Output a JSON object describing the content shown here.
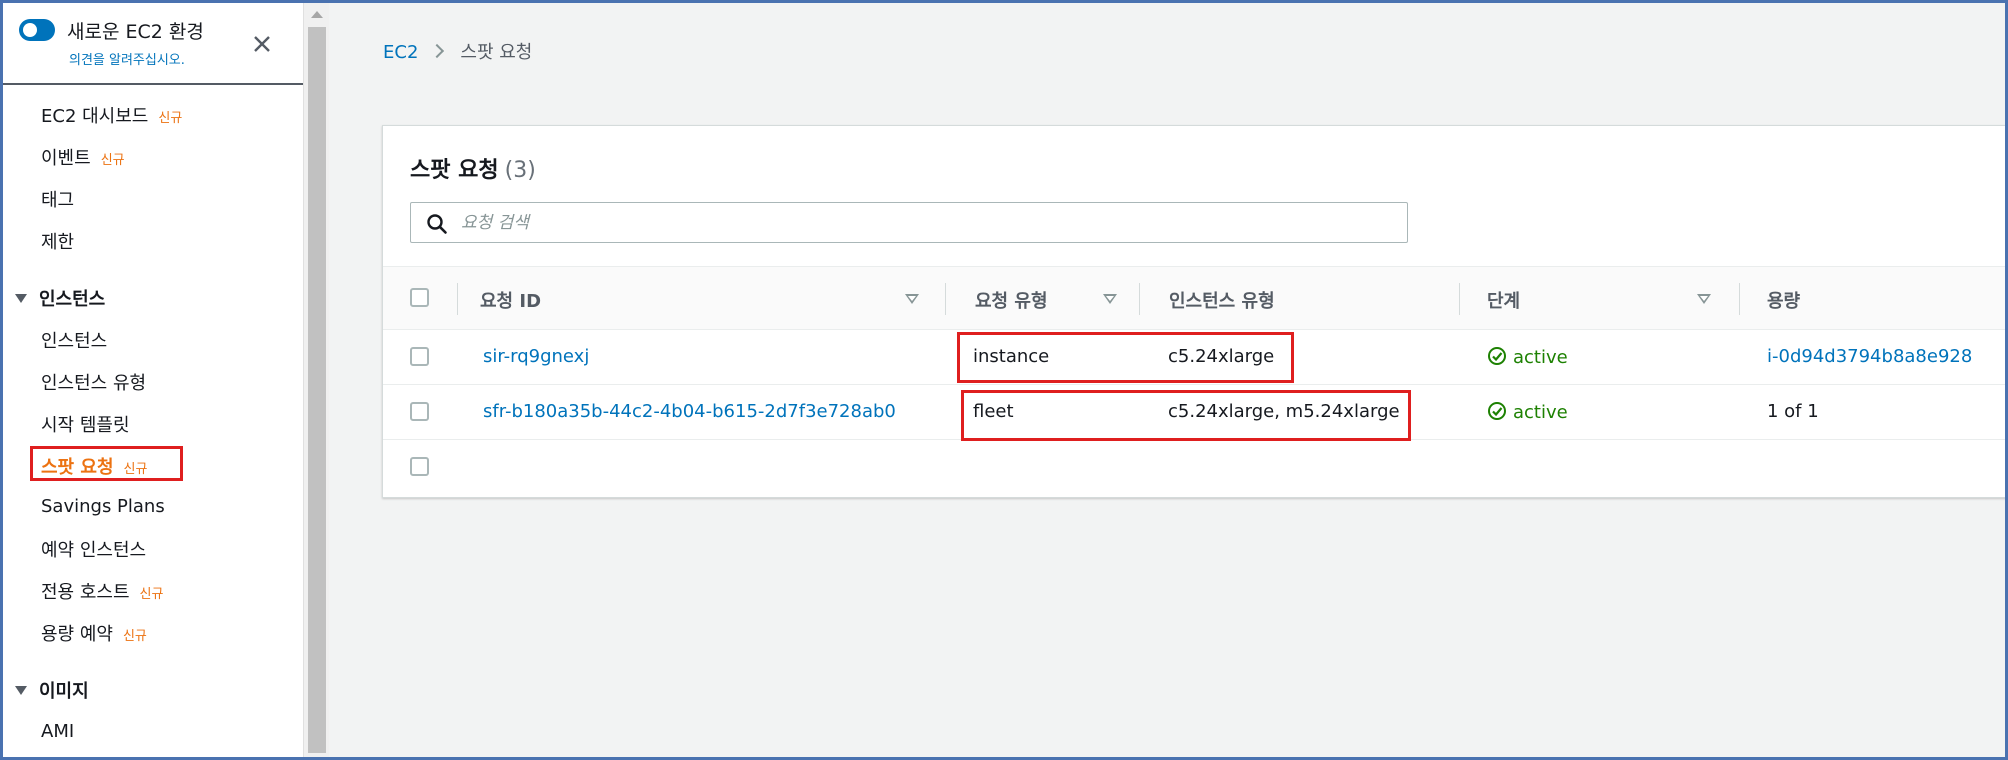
{
  "sidebar": {
    "toggle_title": "새로운 EC2 환경",
    "toggle_subtitle": "의견을 알려주십시오.",
    "new_badge": "신규",
    "items": [
      {
        "label": "EC2 대시보드",
        "new": "신규"
      },
      {
        "label": "이벤트",
        "new": "신규"
      },
      {
        "label": "태그"
      },
      {
        "label": "제한"
      }
    ],
    "section_instances": "인스턴스",
    "instance_items": [
      {
        "label": "인스턴스"
      },
      {
        "label": "인스턴스 유형"
      },
      {
        "label": "시작 템플릿"
      },
      {
        "label": "스팟 요청",
        "new": "신규"
      },
      {
        "label": "Savings Plans"
      },
      {
        "label": "예약 인스턴스"
      },
      {
        "label": "전용 호스트",
        "new": "신규"
      },
      {
        "label": "용량 예약",
        "new": "신규"
      }
    ],
    "section_images": "이미지",
    "image_items": [
      {
        "label": "AMI"
      }
    ],
    "active_item": "스팟 요청"
  },
  "breadcrumb": {
    "root": "EC2",
    "current": "스팟 요청"
  },
  "panel": {
    "title": "스팟 요청",
    "count": "(3)",
    "search_placeholder": "요청 검색"
  },
  "table": {
    "columns": [
      "요청 ID",
      "요청 유형",
      "인스턴스 유형",
      "단계",
      "용량"
    ],
    "rows": [
      {
        "request_id": "sir-rq9gnexj",
        "request_type": "instance",
        "instance_type": "c5.24xlarge",
        "state": "active",
        "capacity": "i-0d94d3794b8a8e928"
      },
      {
        "request_id": "sfr-b180a35b-44c2-4b04-b615-2d7f3e728ab0",
        "request_type": "fleet",
        "instance_type": "c5.24xlarge, m5.24xlarge",
        "state": "active",
        "capacity": "1 of 1"
      }
    ]
  },
  "colors": {
    "accent_link": "#0073bb",
    "new_badge": "#ec7211",
    "status_active": "#1d8102",
    "highlight_box": "#df1f1f"
  },
  "icons": [
    "toggle-switch",
    "close-icon",
    "chevron-right-icon",
    "search-icon",
    "sort-icon",
    "check-circle-icon",
    "caret-down-icon"
  ]
}
